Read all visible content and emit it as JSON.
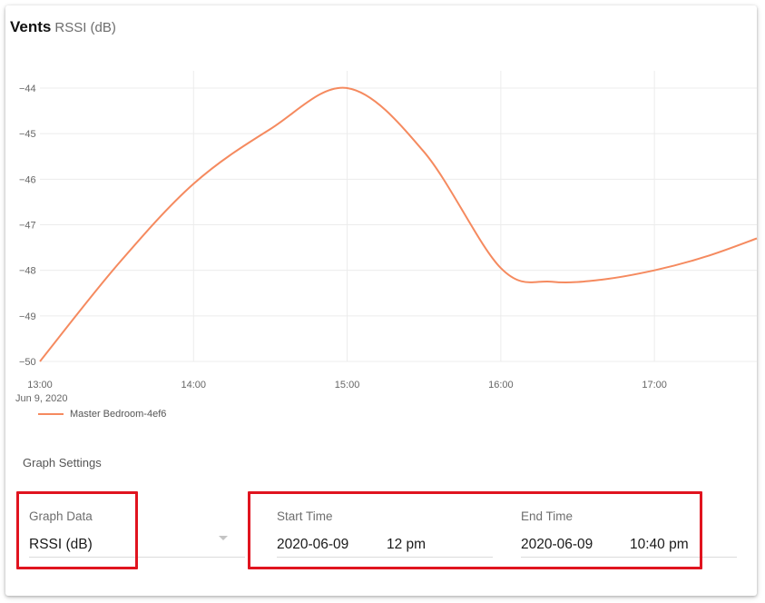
{
  "title": {
    "main": "Vents",
    "sub": "RSSI (dB)"
  },
  "chart_data": {
    "type": "line",
    "x_ticks": [
      "13:00",
      "14:00",
      "15:00",
      "16:00",
      "17:00"
    ],
    "x_tick_sublabel": "Jun 9, 2020",
    "y_ticks": [
      -44,
      -45,
      -46,
      -47,
      -48,
      -49,
      -50
    ],
    "ylim": [
      -50,
      -44
    ],
    "xlim": [
      "13:00",
      "17:40"
    ],
    "grid": true,
    "legend_placement": "bottom-left",
    "series": [
      {
        "name": "Master Bedroom-4ef6",
        "color": "#f58a5f",
        "x": [
          "13:00",
          "13:30",
          "14:00",
          "14:30",
          "15:00",
          "15:30",
          "16:00",
          "16:20",
          "16:40",
          "17:00",
          "17:20",
          "17:40"
        ],
        "y": [
          -50,
          -47.9,
          -46.1,
          -44.9,
          -44.0,
          -45.4,
          -47.95,
          -48.25,
          -48.2,
          -48.0,
          -47.7,
          -47.3
        ]
      }
    ]
  },
  "settings": {
    "title": "Graph Settings",
    "graph_data": {
      "label": "Graph Data",
      "value": "RSSI (dB)"
    },
    "start_time": {
      "label": "Start Time",
      "date": "2020-06-09",
      "time": "12 pm"
    },
    "end_time": {
      "label": "End Time",
      "date": "2020-06-09",
      "time": "10:40 pm"
    }
  },
  "colors": {
    "highlight": "#e0141f",
    "series": "#f58a5f"
  }
}
